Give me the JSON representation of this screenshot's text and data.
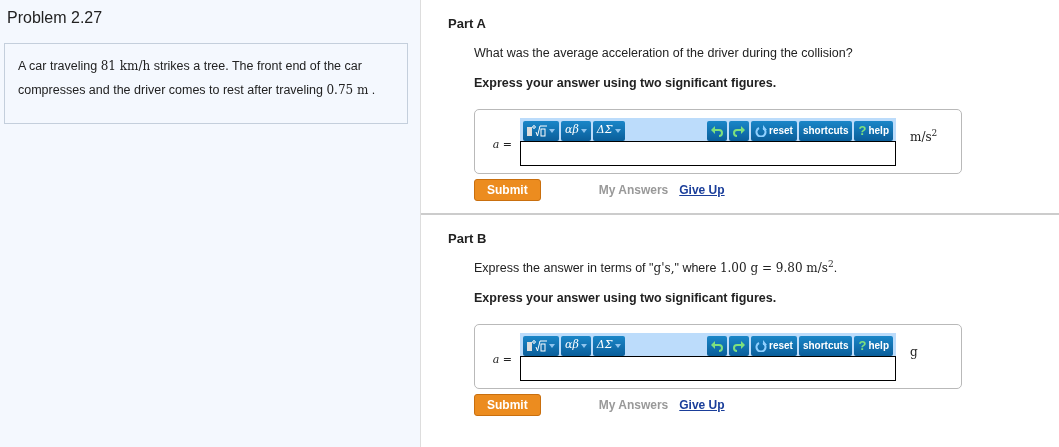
{
  "problem": {
    "title": "Problem 2.27",
    "statement": [
      {
        "kind": "text",
        "text": "A car traveling "
      },
      {
        "kind": "math",
        "text": "81 km/h"
      },
      {
        "kind": "text",
        "text": " strikes a tree. The front end of the car compresses and the driver comes to rest after traveling "
      },
      {
        "kind": "math",
        "text": "0.75 m"
      },
      {
        "kind": "text",
        "text": " ."
      }
    ]
  },
  "parts": [
    {
      "label": "Part A",
      "question": [
        {
          "kind": "text",
          "text": "What was the average acceleration of the driver during the collision?"
        }
      ],
      "instruction": "Express your answer using two significant figures.",
      "variable": "a =",
      "unit": "m/s$^{2}$",
      "toolbar": [
        {
          "kind": "template"
        },
        {
          "kind": "menu",
          "text": "αβ"
        },
        {
          "kind": "menu",
          "text": "ΔΣ"
        },
        {
          "kind": "undo"
        },
        {
          "kind": "redo"
        },
        {
          "kind": "reset",
          "text": "reset"
        },
        {
          "kind": "plain",
          "text": "shortcuts"
        },
        {
          "kind": "help",
          "text": "help",
          "mark": "?"
        }
      ],
      "submit": "Submit",
      "my_answers": "My Answers",
      "give_up": "Give Up"
    },
    {
      "label": "Part B",
      "question": [
        {
          "kind": "text",
          "text": "Express the answer in terms of \""
        },
        {
          "kind": "math",
          "text": "g's,"
        },
        {
          "kind": "text",
          "text": "\" where "
        },
        {
          "kind": "math",
          "text": "1.00 g = 9.80 m/s$^{2}$"
        },
        {
          "kind": "text",
          "text": "."
        }
      ],
      "instruction": "Express your answer using two significant figures.",
      "variable": "a =",
      "unit": "g",
      "toolbar": [
        {
          "kind": "template"
        },
        {
          "kind": "menu",
          "text": "αβ"
        },
        {
          "kind": "menu",
          "text": "ΔΣ"
        },
        {
          "kind": "undo"
        },
        {
          "kind": "redo"
        },
        {
          "kind": "reset",
          "text": "reset"
        },
        {
          "kind": "plain",
          "text": "shortcuts"
        },
        {
          "kind": "help",
          "text": "help",
          "mark": "?"
        }
      ],
      "submit": "Submit",
      "my_answers": "My Answers",
      "give_up": "Give Up"
    }
  ]
}
